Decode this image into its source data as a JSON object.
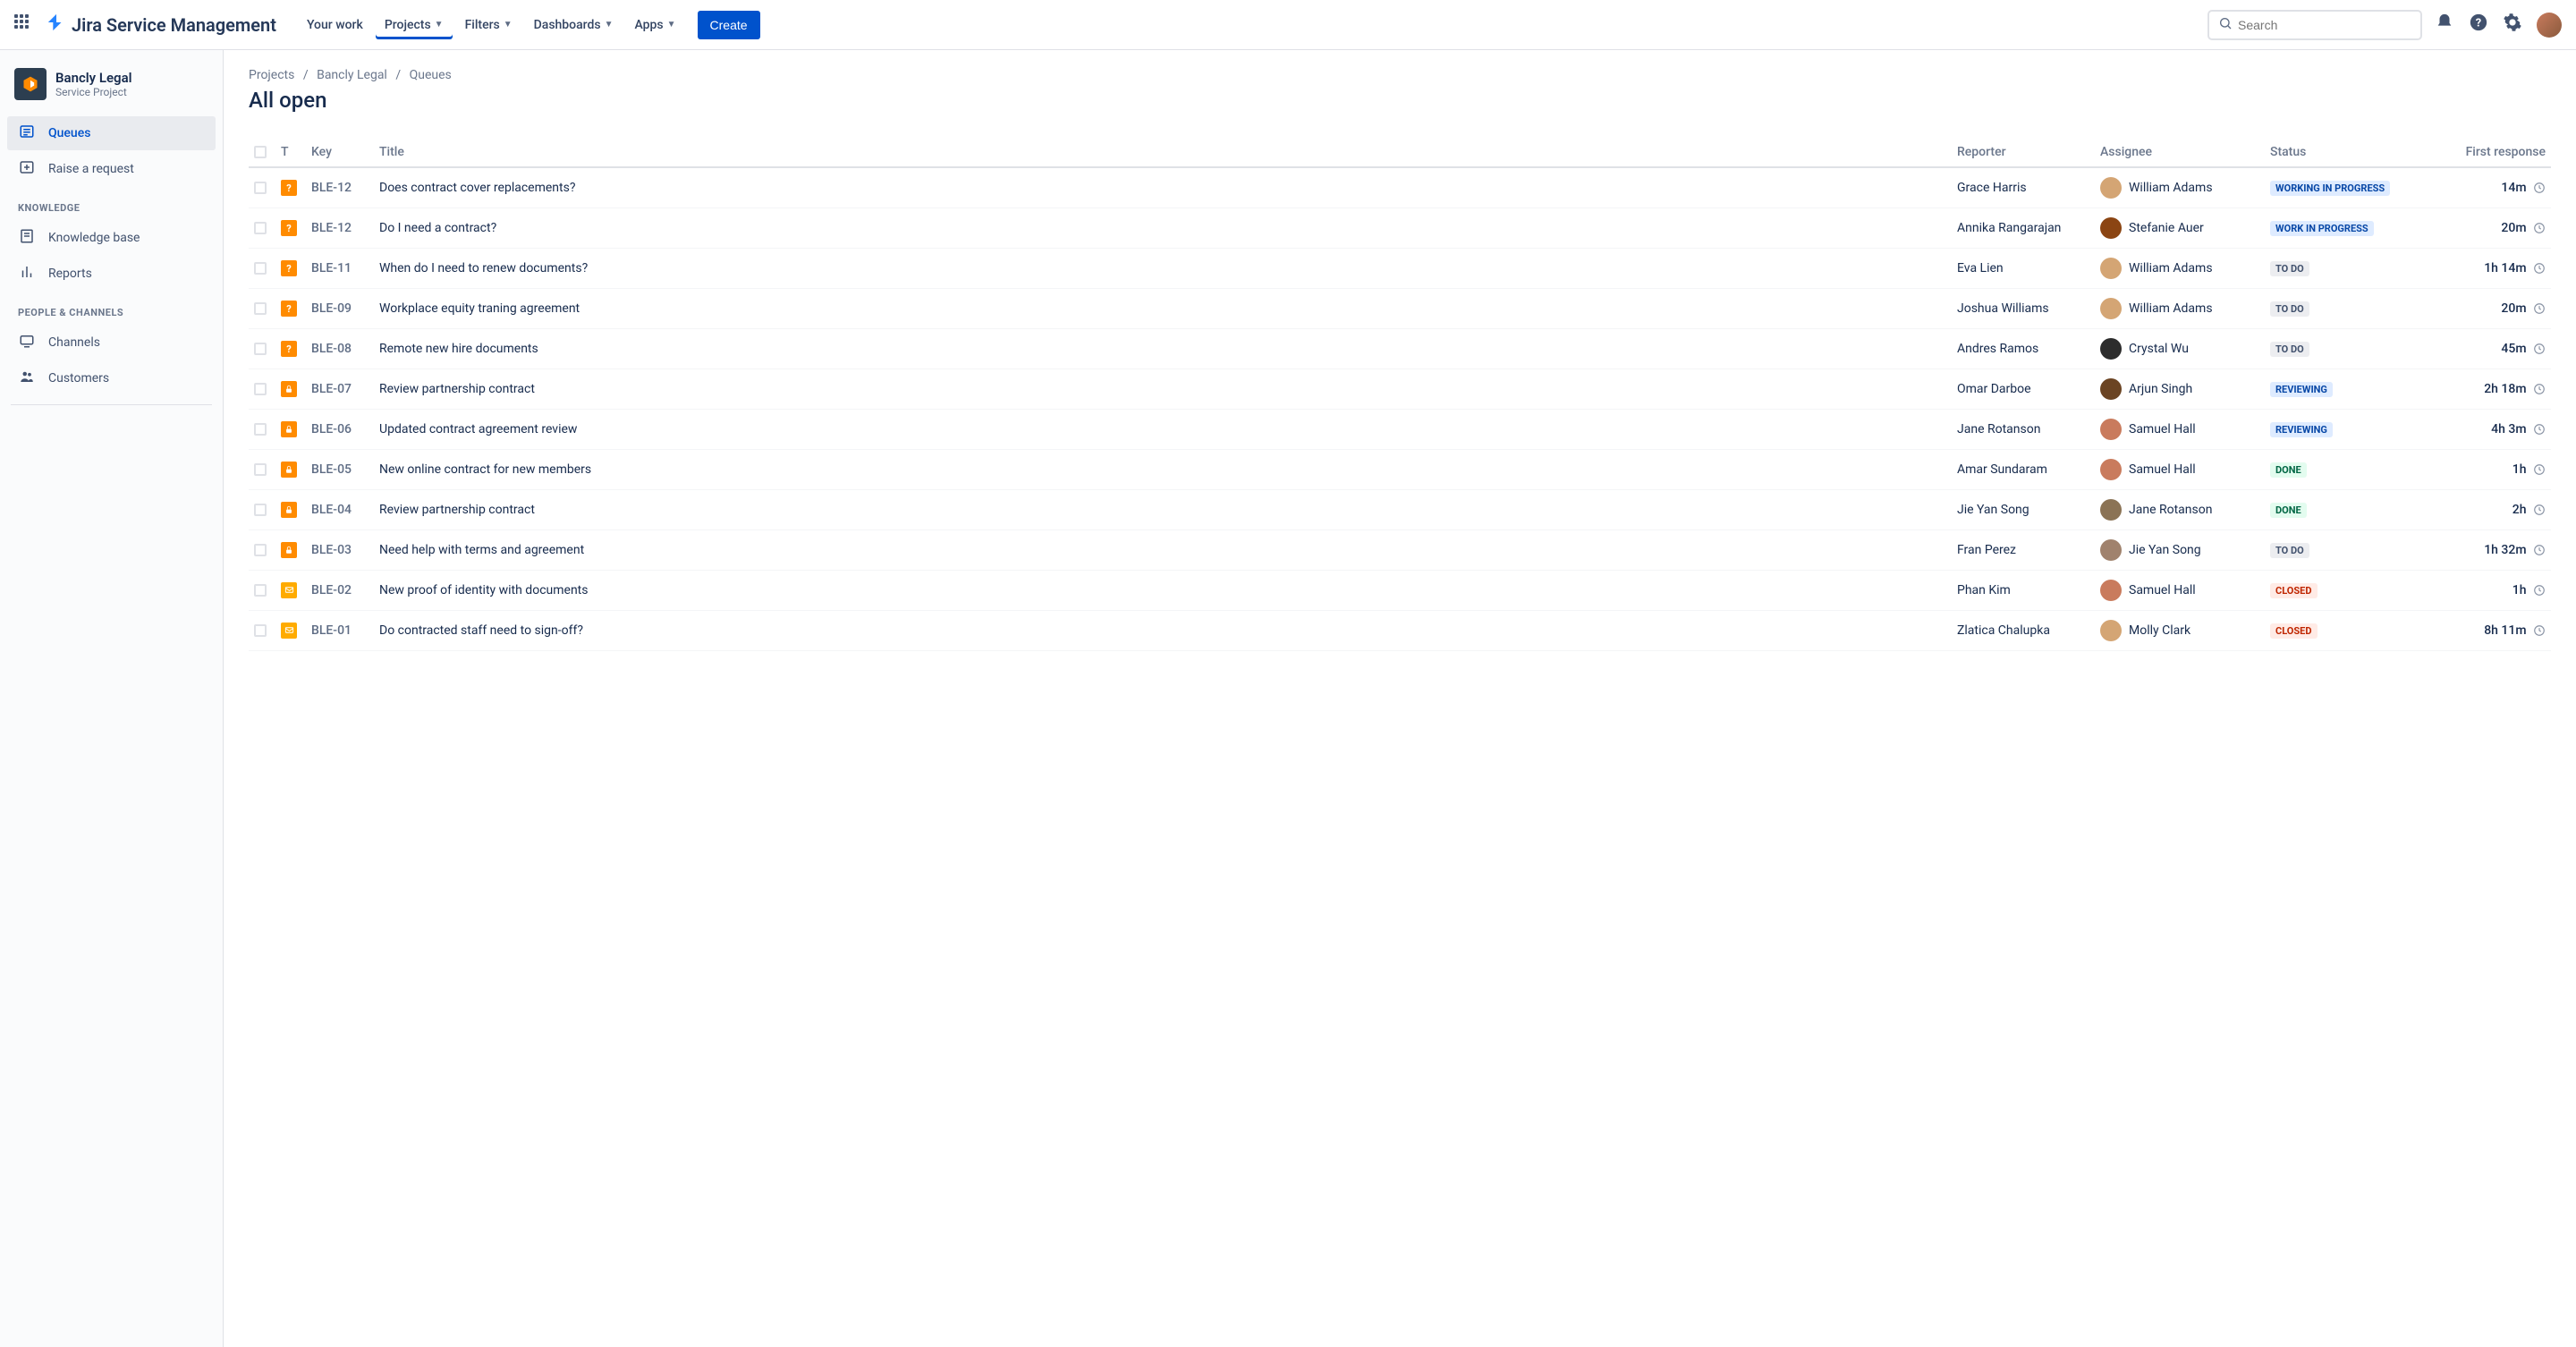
{
  "app_name": "Jira Service Management",
  "nav": {
    "your_work": "Your work",
    "projects": "Projects",
    "filters": "Filters",
    "dashboards": "Dashboards",
    "apps": "Apps",
    "create": "Create"
  },
  "search_placeholder": "Search",
  "project": {
    "name": "Bancly Legal",
    "subtitle": "Service Project"
  },
  "sidebar": {
    "queues": "Queues",
    "raise_request": "Raise a request",
    "section_knowledge": "KNOWLEDGE",
    "knowledge_base": "Knowledge base",
    "reports": "Reports",
    "section_people": "PEOPLE & CHANNELS",
    "channels": "Channels",
    "customers": "Customers"
  },
  "breadcrumb": {
    "projects": "Projects",
    "project_name": "Bancly Legal",
    "current": "Queues"
  },
  "page_title": "All open",
  "columns": {
    "t": "T",
    "key": "Key",
    "title": "Title",
    "reporter": "Reporter",
    "assignee": "Assignee",
    "status": "Status",
    "first_response": "First response"
  },
  "status_classes": {
    "WORKING IN PROGRESS": "lz-blue",
    "WORK IN PROGRESS": "lz-blue",
    "TO DO": "lz-grey",
    "REVIEWING": "lz-blue",
    "DONE": "lz-green",
    "CLOSED": "lz-red"
  },
  "rows": [
    {
      "type": "question",
      "key": "BLE-12",
      "title": "Does contract cover replacements?",
      "reporter": "Grace Harris",
      "assignee": "William Adams",
      "av": "#d4a574",
      "status": "WORKING IN PROGRESS",
      "first": "14m"
    },
    {
      "type": "question",
      "key": "BLE-12",
      "title": "Do I need a contract?",
      "reporter": "Annika Rangarajan",
      "assignee": "Stefanie Auer",
      "av": "#8b4513",
      "status": "WORK IN PROGRESS",
      "first": "20m"
    },
    {
      "type": "question",
      "key": "BLE-11",
      "title": "When do I need to renew documents?",
      "reporter": "Eva Lien",
      "assignee": "William Adams",
      "av": "#d4a574",
      "status": "TO DO",
      "first": "1h 14m"
    },
    {
      "type": "question",
      "key": "BLE-09",
      "title": "Workplace equity traning agreement",
      "reporter": "Joshua Williams",
      "assignee": "William Adams",
      "av": "#d4a574",
      "status": "TO DO",
      "first": "20m"
    },
    {
      "type": "question",
      "key": "BLE-08",
      "title": "Remote new hire documents",
      "reporter": "Andres Ramos",
      "assignee": "Crystal Wu",
      "av": "#2c2c2c",
      "status": "TO DO",
      "first": "45m"
    },
    {
      "type": "lock",
      "key": "BLE-07",
      "title": "Review partnership contract",
      "reporter": "Omar Darboe",
      "assignee": "Arjun Singh",
      "av": "#6b4423",
      "status": "REVIEWING",
      "first": "2h 18m"
    },
    {
      "type": "lock",
      "key": "BLE-06",
      "title": "Updated contract agreement review",
      "reporter": "Jane Rotanson",
      "assignee": "Samuel Hall",
      "av": "#c97b5d",
      "status": "REVIEWING",
      "first": "4h 3m"
    },
    {
      "type": "lock",
      "key": "BLE-05",
      "title": "New online contract for new members",
      "reporter": "Amar Sundaram",
      "assignee": "Samuel Hall",
      "av": "#c97b5d",
      "status": "DONE",
      "first": "1h"
    },
    {
      "type": "lock",
      "key": "BLE-04",
      "title": "Review partnership contract",
      "reporter": "Jie Yan Song",
      "assignee": "Jane Rotanson",
      "av": "#8b7355",
      "status": "DONE",
      "first": "2h"
    },
    {
      "type": "lock",
      "key": "BLE-03",
      "title": "Need help with terms and agreement",
      "reporter": "Fran Perez",
      "assignee": "Jie Yan Song",
      "av": "#a0826d",
      "status": "TO DO",
      "first": "1h 32m"
    },
    {
      "type": "mail",
      "key": "BLE-02",
      "title": "New proof of identity with documents",
      "reporter": "Phan Kim",
      "assignee": "Samuel Hall",
      "av": "#c97b5d",
      "status": "CLOSED",
      "first": "1h"
    },
    {
      "type": "mail",
      "key": "BLE-01",
      "title": "Do contracted staff need to sign-off?",
      "reporter": "Zlatica Chalupka",
      "assignee": "Molly Clark",
      "av": "#d4a574",
      "status": "CLOSED",
      "first": "8h 11m"
    }
  ]
}
